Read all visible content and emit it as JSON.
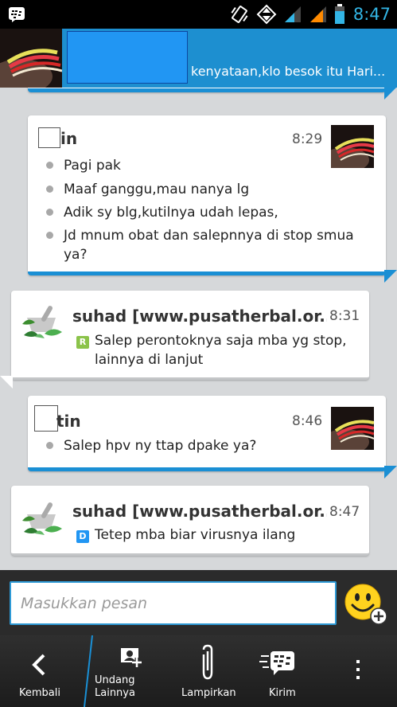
{
  "status_bar": {
    "time": "8:47",
    "icons": [
      "bbm-icon",
      "vibrate-icon",
      "data-icon",
      "signal-icon",
      "signal-icon-2",
      "battery-icon"
    ]
  },
  "chat_header": {
    "status_message": "kenyataan,klo besok itu Hari..."
  },
  "messages": [
    {
      "sender": "in",
      "time": "8:29",
      "lines": [
        "Pagi pak",
        "Maaf ganggu,mau nanya lg",
        "Adik sy blg,kutilnya udah lepas,",
        "Jd mnum obat dan salepnnya di stop smua",
        "ya?"
      ]
    },
    {
      "sender": "suhad [www.pusatherbal.or...",
      "time": "8:31",
      "status": "R",
      "lines": [
        "Salep perontoknya saja mba yg stop,",
        "lainnya di lanjut"
      ]
    },
    {
      "sender": "tin",
      "time": "8:46",
      "lines": [
        "Salep hpv ny ttap dpake ya?"
      ]
    },
    {
      "sender": "suhad [www.pusatherbal.or...",
      "time": "8:47",
      "status": "D",
      "lines": [
        "Tetep mba biar virusnya ilang"
      ]
    }
  ],
  "compose": {
    "placeholder": "Masukkan pesan"
  },
  "toolbar": {
    "back_label": "Kembali",
    "invite_label_1": "Undang",
    "invite_label_2": "Lainnya",
    "attach_label": "Lampirkan",
    "send_label": "Kirim"
  },
  "colors": {
    "accent": "#1a8fd4",
    "status_r": "#8bc34a",
    "status_d": "#2196f3",
    "emoji": "#ffd21f"
  }
}
